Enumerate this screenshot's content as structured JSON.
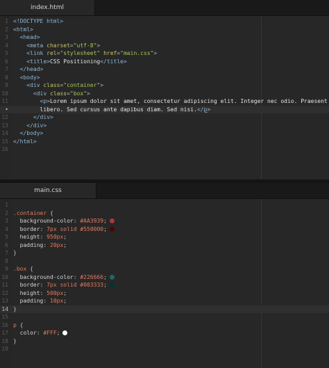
{
  "top": {
    "tab_label": "index.html",
    "lines": [
      {
        "n": "1",
        "segs": [
          [
            "t-tag",
            "<!DOCTYPE html>"
          ]
        ]
      },
      {
        "n": "2",
        "segs": [
          [
            "t-tag",
            "<html>"
          ]
        ]
      },
      {
        "n": "3",
        "segs": [
          [
            "t-punc",
            "  "
          ],
          [
            "t-tag",
            "<head>"
          ]
        ]
      },
      {
        "n": "4",
        "segs": [
          [
            "t-punc",
            "    "
          ],
          [
            "t-tag",
            "<meta "
          ],
          [
            "t-attr",
            "charset"
          ],
          [
            "t-punc",
            "="
          ],
          [
            "t-str",
            "\"utf-8\""
          ],
          [
            "t-tag",
            ">"
          ]
        ]
      },
      {
        "n": "5",
        "segs": [
          [
            "t-punc",
            "    "
          ],
          [
            "t-tag",
            "<link "
          ],
          [
            "t-attr",
            "rel"
          ],
          [
            "t-punc",
            "="
          ],
          [
            "t-str",
            "\"stylesheet\""
          ],
          [
            "t-attr",
            " href"
          ],
          [
            "t-punc",
            "="
          ],
          [
            "t-str",
            "\"main.css\""
          ],
          [
            "t-tag",
            ">"
          ]
        ]
      },
      {
        "n": "6",
        "segs": [
          [
            "t-punc",
            "    "
          ],
          [
            "t-tag",
            "<title>"
          ],
          [
            "t-text",
            "CSS Positioning"
          ],
          [
            "t-tag",
            "</title>"
          ]
        ]
      },
      {
        "n": "7",
        "segs": [
          [
            "t-punc",
            "  "
          ],
          [
            "t-tag",
            "</head>"
          ]
        ]
      },
      {
        "n": "8",
        "segs": [
          [
            "t-punc",
            "  "
          ],
          [
            "t-tag",
            "<body>"
          ]
        ]
      },
      {
        "n": "9",
        "segs": [
          [
            "t-punc",
            "    "
          ],
          [
            "t-tag",
            "<div "
          ],
          [
            "t-attr",
            "class"
          ],
          [
            "t-punc",
            "="
          ],
          [
            "t-str",
            "\"container\""
          ],
          [
            "t-tag",
            ">"
          ]
        ]
      },
      {
        "n": "10",
        "segs": [
          [
            "t-punc",
            "      "
          ],
          [
            "t-tag",
            "<div "
          ],
          [
            "t-attr",
            "class"
          ],
          [
            "t-punc",
            "="
          ],
          [
            "t-str",
            "\"box\""
          ],
          [
            "t-tag",
            ">"
          ]
        ]
      },
      {
        "n": "11",
        "segs": [
          [
            "t-punc",
            "        "
          ],
          [
            "t-tag",
            "<p>"
          ],
          [
            "t-text",
            "Lorem ipsum dolor sit amet, consectetur adipiscing elit. Integer nec odio. Praesent"
          ]
        ]
      },
      {
        "n": "•",
        "current": true,
        "segs": [
          [
            "t-punc",
            "        "
          ],
          [
            "t-text",
            "libero. Sed cursus ante dapibus diam. Sed nisi."
          ],
          [
            "t-tag",
            "</"
          ],
          [
            "t-tag ul",
            "p"
          ],
          [
            "t-tag",
            ">"
          ]
        ]
      },
      {
        "n": "12",
        "segs": [
          [
            "t-punc",
            "      "
          ],
          [
            "t-tag",
            "</div>"
          ]
        ]
      },
      {
        "n": "13",
        "segs": [
          [
            "t-punc",
            "    "
          ],
          [
            "t-tag",
            "</div>"
          ]
        ]
      },
      {
        "n": "14",
        "segs": [
          [
            "t-punc",
            "  "
          ],
          [
            "t-tag",
            "</body>"
          ]
        ]
      },
      {
        "n": "15",
        "segs": [
          [
            "t-tag",
            "</html>"
          ]
        ]
      },
      {
        "n": "16",
        "segs": []
      }
    ]
  },
  "bottom": {
    "tab_label": "main.css",
    "lines": [
      {
        "n": "1",
        "segs": []
      },
      {
        "n": "2",
        "segs": [
          [
            "t-sel",
            ".container"
          ],
          [
            "t-punc",
            " {"
          ]
        ]
      },
      {
        "n": "3",
        "segs": [
          [
            "t-punc",
            "  "
          ],
          [
            "t-prop",
            "background-color"
          ],
          [
            "t-punc",
            ": "
          ],
          [
            "t-hex",
            "#AA3939"
          ],
          [
            "t-punc",
            ";"
          ]
        ],
        "swatch": "#AA3939"
      },
      {
        "n": "4",
        "segs": [
          [
            "t-punc",
            "  "
          ],
          [
            "t-prop",
            "border"
          ],
          [
            "t-punc",
            ": "
          ],
          [
            "t-num",
            "7"
          ],
          [
            "t-unit",
            "px"
          ],
          [
            "t-kw",
            " solid "
          ],
          [
            "t-hex",
            "#550000"
          ],
          [
            "t-punc",
            ";"
          ]
        ],
        "swatch": "#550000"
      },
      {
        "n": "5",
        "segs": [
          [
            "t-punc",
            "  "
          ],
          [
            "t-prop",
            "height"
          ],
          [
            "t-punc",
            ": "
          ],
          [
            "t-num",
            "950"
          ],
          [
            "t-unit",
            "px"
          ],
          [
            "t-punc",
            ";"
          ]
        ]
      },
      {
        "n": "6",
        "segs": [
          [
            "t-punc",
            "  "
          ],
          [
            "t-prop",
            "padding"
          ],
          [
            "t-punc",
            ": "
          ],
          [
            "t-num",
            "20"
          ],
          [
            "t-unit",
            "px"
          ],
          [
            "t-punc",
            ";"
          ]
        ]
      },
      {
        "n": "7",
        "segs": [
          [
            "t-punc",
            "}"
          ]
        ]
      },
      {
        "n": "8",
        "segs": []
      },
      {
        "n": "9",
        "segs": [
          [
            "t-sel",
            ".box"
          ],
          [
            "t-punc",
            " {"
          ]
        ]
      },
      {
        "n": "10",
        "segs": [
          [
            "t-punc",
            "  "
          ],
          [
            "t-prop",
            "background-color"
          ],
          [
            "t-punc",
            ": "
          ],
          [
            "t-hex",
            "#226666"
          ],
          [
            "t-punc",
            ";"
          ]
        ],
        "swatch": "#226666"
      },
      {
        "n": "11",
        "segs": [
          [
            "t-punc",
            "  "
          ],
          [
            "t-prop",
            "border"
          ],
          [
            "t-punc",
            ": "
          ],
          [
            "t-num",
            "7"
          ],
          [
            "t-unit",
            "px"
          ],
          [
            "t-kw",
            " solid "
          ],
          [
            "t-hex",
            "#003333"
          ],
          [
            "t-punc",
            ";"
          ]
        ],
        "swatch": "#003333"
      },
      {
        "n": "12",
        "segs": [
          [
            "t-punc",
            "  "
          ],
          [
            "t-prop",
            "height"
          ],
          [
            "t-punc",
            ": "
          ],
          [
            "t-num",
            "500"
          ],
          [
            "t-unit",
            "px"
          ],
          [
            "t-punc",
            ";"
          ]
        ]
      },
      {
        "n": "13",
        "segs": [
          [
            "t-punc",
            "  "
          ],
          [
            "t-prop",
            "padding"
          ],
          [
            "t-punc",
            ": "
          ],
          [
            "t-num",
            "10"
          ],
          [
            "t-unit",
            "px"
          ],
          [
            "t-punc",
            ";"
          ]
        ]
      },
      {
        "n": "14",
        "current": true,
        "segs": [
          [
            "t-punc",
            "}"
          ]
        ]
      },
      {
        "n": "15",
        "segs": []
      },
      {
        "n": "16",
        "segs": [
          [
            "t-sel",
            "p"
          ],
          [
            "t-punc",
            " {"
          ]
        ]
      },
      {
        "n": "17",
        "segs": [
          [
            "t-punc",
            "  "
          ],
          [
            "t-prop",
            "color"
          ],
          [
            "t-punc",
            ": "
          ],
          [
            "t-hex",
            "#FFF"
          ],
          [
            "t-punc",
            ";"
          ]
        ],
        "swatch": "#FFFFFF"
      },
      {
        "n": "18",
        "segs": [
          [
            "t-punc",
            "}"
          ]
        ]
      },
      {
        "n": "19",
        "segs": []
      }
    ]
  }
}
